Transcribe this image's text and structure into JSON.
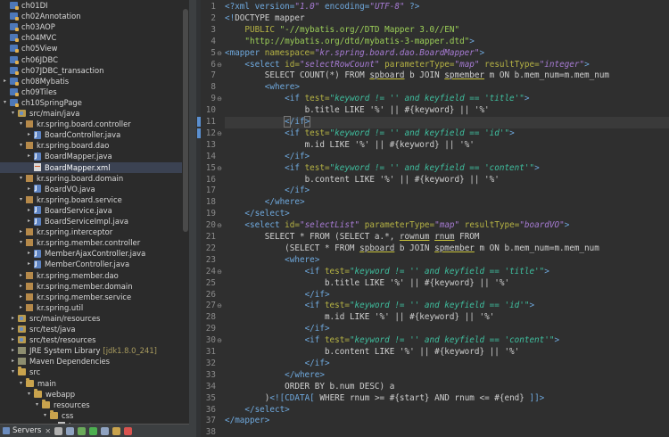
{
  "explorer": {
    "rows": [
      {
        "label": "ch01DI",
        "type": "project",
        "indent": 0,
        "twisty": ""
      },
      {
        "label": "ch02Annotation",
        "type": "project",
        "indent": 0,
        "twisty": ""
      },
      {
        "label": "ch03AOP",
        "type": "project",
        "indent": 0,
        "twisty": ""
      },
      {
        "label": "ch04MVC",
        "type": "project",
        "indent": 0,
        "twisty": ""
      },
      {
        "label": "ch05View",
        "type": "project",
        "indent": 0,
        "twisty": ""
      },
      {
        "label": "ch06JDBC",
        "type": "project",
        "indent": 0,
        "twisty": ""
      },
      {
        "label": "ch07JDBC_transaction",
        "type": "project",
        "indent": 0,
        "twisty": ""
      },
      {
        "label": "ch08Mybatis",
        "type": "project",
        "indent": 0,
        "twisty": "collapsed"
      },
      {
        "label": "ch09Tiles",
        "type": "project",
        "indent": 0,
        "twisty": ""
      },
      {
        "label": "ch10SpringPage",
        "type": "project",
        "indent": 0,
        "twisty": "expanded"
      },
      {
        "label": "src/main/java",
        "type": "srcfolder",
        "indent": 1,
        "twisty": "expanded"
      },
      {
        "label": "kr.spring.board.controller",
        "type": "pkg",
        "indent": 2,
        "twisty": "expanded"
      },
      {
        "label": "BoardController.java",
        "type": "java",
        "indent": 3,
        "twisty": "collapsed"
      },
      {
        "label": "kr.spring.board.dao",
        "type": "pkg",
        "indent": 2,
        "twisty": "expanded"
      },
      {
        "label": "BoardMapper.java",
        "type": "java",
        "indent": 3,
        "twisty": "collapsed"
      },
      {
        "label": "BoardMapper.xml",
        "type": "xml",
        "indent": 3,
        "twisty": "",
        "selected": true
      },
      {
        "label": "kr.spring.board.domain",
        "type": "pkg",
        "indent": 2,
        "twisty": "expanded"
      },
      {
        "label": "BoardVO.java",
        "type": "java",
        "indent": 3,
        "twisty": "collapsed"
      },
      {
        "label": "kr.spring.board.service",
        "type": "pkg",
        "indent": 2,
        "twisty": "expanded"
      },
      {
        "label": "BoardService.java",
        "type": "java",
        "indent": 3,
        "twisty": "collapsed"
      },
      {
        "label": "BoardServiceImpl.java",
        "type": "java",
        "indent": 3,
        "twisty": "collapsed"
      },
      {
        "label": "kr.spring.interceptor",
        "type": "pkg",
        "indent": 2,
        "twisty": "collapsed"
      },
      {
        "label": "kr.spring.member.controller",
        "type": "pkg",
        "indent": 2,
        "twisty": "expanded"
      },
      {
        "label": "MemberAjaxController.java",
        "type": "java",
        "indent": 3,
        "twisty": "collapsed"
      },
      {
        "label": "MemberController.java",
        "type": "java",
        "indent": 3,
        "twisty": "collapsed"
      },
      {
        "label": "kr.spring.member.dao",
        "type": "pkg",
        "indent": 2,
        "twisty": "collapsed"
      },
      {
        "label": "kr.spring.member.domain",
        "type": "pkg",
        "indent": 2,
        "twisty": "collapsed"
      },
      {
        "label": "kr.spring.member.service",
        "type": "pkg",
        "indent": 2,
        "twisty": "collapsed"
      },
      {
        "label": "kr.spring.util",
        "type": "pkg",
        "indent": 2,
        "twisty": "collapsed"
      },
      {
        "label": "src/main/resources",
        "type": "srcfolder",
        "indent": 1,
        "twisty": "collapsed"
      },
      {
        "label": "src/test/java",
        "type": "srcfolder",
        "indent": 1,
        "twisty": "collapsed"
      },
      {
        "label": "src/test/resources",
        "type": "srcfolder",
        "indent": 1,
        "twisty": "collapsed"
      },
      {
        "label": "JRE System Library",
        "suffix": "[jdk1.8.0_241]",
        "type": "lib",
        "indent": 1,
        "twisty": "collapsed"
      },
      {
        "label": "Maven Dependencies",
        "type": "lib",
        "indent": 1,
        "twisty": "collapsed"
      },
      {
        "label": "src",
        "type": "folder",
        "indent": 1,
        "twisty": "expanded"
      },
      {
        "label": "main",
        "type": "folder",
        "indent": 2,
        "twisty": "expanded"
      },
      {
        "label": "webapp",
        "type": "folder",
        "indent": 3,
        "twisty": "expanded"
      },
      {
        "label": "resources",
        "type": "folder",
        "indent": 4,
        "twisty": "expanded"
      },
      {
        "label": "css",
        "type": "folder",
        "indent": 5,
        "twisty": "expanded"
      },
      {
        "label": "layout.css",
        "type": "css",
        "indent": 6,
        "twisty": ""
      }
    ]
  },
  "servers_bar": {
    "label": "Servers"
  },
  "editor": {
    "lines": [
      "<span class='pi'>&lt;?xml version=</span><span class='v'>\"1.0\"</span><span class='pi'> encoding=</span><span class='v'>\"UTF-8\"</span><span class='pi'> ?&gt;</span>",
      "<span class='t'>&lt;!</span><span class='kw'>DOCTYPE mapper</span>",
      "    <span class='a'>PUBLIC </span><span class='vs'>\"-//mybatis.org//DTD Mapper 3.0//EN\"</span>",
      "    <span class='vs'>\"http://mybatis.org/dtd/mybatis-3-mapper.dtd\"</span><span class='t'>&gt;</span>",
      "<span class='t'>&lt;mapper </span><span class='a'>namespace=</span><span class='v'>\"kr.spring.board.dao.BoardMapper\"</span><span class='t'>&gt;</span>",
      "    <span class='t'>&lt;select </span><span class='a'>id=</span><span class='v'>\"selectRowCount\"</span> <span class='a'>parameterType=</span><span class='v'>\"map\"</span> <span class='a'>resultType=</span><span class='v'>\"integer\"</span><span class='t'>&gt;</span>",
      "        <span class='kw'>SELECT COUNT(*) FROM <span class='ul'>spboard</span> b JOIN <span class='ul'>spmember</span> m ON b.mem_num=m.mem_num</span>",
      "        <span class='t'>&lt;where&gt;</span>",
      "            <span class='t'>&lt;if </span><span class='a'>test=</span><span class='vg'>\"keyword != '' and keyfield == 'title'\"</span><span class='t'>&gt;</span>",
      "                <span class='kw'>b.title LIKE '%' || #{keyword} || '%'</span>",
      "            <span class='t'><span class='br'>&lt;</span>/if<span class='br'>&gt;</span></span>",
      "            <span class='t'>&lt;if </span><span class='a'>test=</span><span class='vg'>\"keyword != '' and keyfield == 'id'\"</span><span class='t'>&gt;</span>",
      "                <span class='kw'>m.id LIKE '%' || #{keyword} || '%'</span>",
      "            <span class='t'>&lt;/if&gt;</span>",
      "            <span class='t'>&lt;if </span><span class='a'>test=</span><span class='vg'>\"keyword != '' and keyfield == 'content'\"</span><span class='t'>&gt;</span>",
      "                <span class='kw'>b.content LIKE '%' || #{keyword} || '%'</span>",
      "            <span class='t'>&lt;/if&gt;</span>",
      "        <span class='t'>&lt;/where&gt;</span>",
      "    <span class='t'>&lt;/select&gt;</span>",
      "    <span class='t'>&lt;select </span><span class='a'>id=</span><span class='v'>\"selectList\"</span> <span class='a'>parameterType=</span><span class='v'>\"map\"</span> <span class='a'>resultType=</span><span class='v'>\"boardVO\"</span><span class='t'>&gt;</span>",
      "        <span class='kw'>SELECT * FROM (SELECT a.*, <span class='ul'>rownum</span> <span class='ul'>rnum</span> FROM</span>",
      "            <span class='kw'>(SELECT * FROM <span class='ul'>spboard</span> b JOIN <span class='ul'>spmember</span> m ON b.mem_num=m.mem_num</span>",
      "            <span class='t'>&lt;where&gt;</span>",
      "                <span class='t'>&lt;if </span><span class='a'>test=</span><span class='vg'>\"keyword != '' and keyfield == 'title'\"</span><span class='t'>&gt;</span>",
      "                    <span class='kw'>b.title LIKE '%' || #{keyword} || '%'</span>",
      "                <span class='t'>&lt;/if&gt;</span>",
      "                <span class='t'>&lt;if </span><span class='a'>test=</span><span class='vg'>\"keyword != '' and keyfield == 'id'\"</span><span class='t'>&gt;</span>",
      "                    <span class='kw'>m.id LIKE '%' || #{keyword} || '%'</span>",
      "                <span class='t'>&lt;/if&gt;</span>",
      "                <span class='t'>&lt;if </span><span class='a'>test=</span><span class='vg'>\"keyword != '' and keyfield == 'content'\"</span><span class='t'>&gt;</span>",
      "                    <span class='kw'>b.content LIKE '%' || #{keyword} || '%'</span>",
      "                <span class='t'>&lt;/if&gt;</span>",
      "            <span class='t'>&lt;/where&gt;</span>",
      "            <span class='kw'>ORDER BY b.num DESC) a</span>",
      "        <span class='kw'>)</span><span class='t'>&lt;![</span><span class='cd'>CDATA[</span><span class='kw'> WHERE rnum &gt;= #{start} AND rnum &lt;= #{end} </span><span class='cd'>]]&gt;</span>",
      "    <span class='t'>&lt;/select&gt;</span>",
      "<span class='t'>&lt;/mapper&gt;</span>",
      "",
      ""
    ],
    "fold_lines": [
      5,
      6,
      9,
      12,
      15,
      20,
      24,
      27,
      30
    ],
    "current_line": 11,
    "changed_lines": [
      11,
      12
    ]
  }
}
